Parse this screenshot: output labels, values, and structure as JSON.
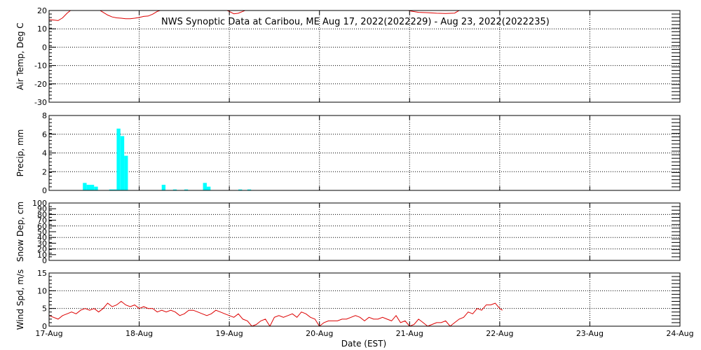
{
  "chart_data": [
    {
      "type": "line",
      "title": "NWS Synoptic Data at Caribou, ME   Aug 17, 2022(2022229) - Aug 23, 2022(2022235)",
      "ylabel": "Air Temp, Deg C",
      "ylim": [
        -30,
        20
      ],
      "yticks": [
        "-30",
        "-20",
        "-10",
        "0",
        "10",
        "20"
      ],
      "x_unit": "days after Aug 17 00:00 EST",
      "series": [
        {
          "color": "#dd0000",
          "x": [
            0.0,
            0.05,
            0.1,
            0.15,
            0.2,
            0.25,
            0.3,
            0.4,
            0.5,
            0.55,
            0.6,
            0.65,
            0.7,
            0.75,
            0.8,
            0.85,
            0.9,
            0.95,
            1.0,
            1.05,
            1.1,
            1.15,
            1.2,
            1.3
          ],
          "y": [
            15,
            14.8,
            14.5,
            16,
            18.5,
            20.5,
            22,
            23,
            22,
            20.5,
            19,
            17.5,
            16.5,
            16,
            15.8,
            15.5,
            15.5,
            15.8,
            16.2,
            16.8,
            17,
            18,
            19.5,
            21
          ]
        },
        {
          "color": "#dd0000",
          "x": [
            1.95,
            2.0,
            2.05,
            2.1,
            2.15,
            2.2,
            2.25
          ],
          "y": [
            20.5,
            19.5,
            18.2,
            18.5,
            19.5,
            20.5,
            22
          ]
        },
        {
          "color": "#dd0000",
          "x": [
            3.9,
            3.95,
            4.0,
            4.1,
            4.2,
            4.3,
            4.4,
            4.5,
            4.55
          ],
          "y": [
            22,
            20.5,
            19.8,
            19,
            18.8,
            18.5,
            18.4,
            18.6,
            20
          ]
        }
      ]
    },
    {
      "type": "bar",
      "ylabel": "Precip, mm",
      "ylim": [
        0,
        8
      ],
      "yticks": [
        "0",
        "2",
        "4",
        "6",
        "8"
      ],
      "color": "#00ffff",
      "bar_width_days": 0.041667,
      "bars": [
        {
          "x": 0.375,
          "value": 0.8
        },
        {
          "x": 0.417,
          "value": 0.6
        },
        {
          "x": 0.458,
          "value": 0.6
        },
        {
          "x": 0.5,
          "value": 0.4
        },
        {
          "x": 0.667,
          "value": 0.1
        },
        {
          "x": 0.708,
          "value": 0.1
        },
        {
          "x": 0.75,
          "value": 6.6
        },
        {
          "x": 0.792,
          "value": 5.8
        },
        {
          "x": 0.833,
          "value": 3.7
        },
        {
          "x": 1.25,
          "value": 0.6
        },
        {
          "x": 1.375,
          "value": 0.1
        },
        {
          "x": 1.5,
          "value": 0.1
        },
        {
          "x": 1.708,
          "value": 0.8
        },
        {
          "x": 1.75,
          "value": 0.4
        },
        {
          "x": 2.1,
          "value": 0.1
        },
        {
          "x": 2.2,
          "value": 0.1
        }
      ]
    },
    {
      "type": "line",
      "ylabel": "Snow Dep, cm",
      "ylim": [
        0,
        100
      ],
      "yticks": [
        "0",
        "20",
        "40",
        "60",
        "80",
        "100"
      ],
      "extra_yticks": [
        "10",
        "30",
        "50",
        "70",
        "90"
      ],
      "series": []
    },
    {
      "type": "line",
      "ylabel": "Wind Spd, m/s",
      "ylim": [
        0,
        15
      ],
      "yticks": [
        "0",
        "5",
        "10",
        "15"
      ],
      "xlabel": "Date (EST)",
      "categories": [
        "17-Aug",
        "18-Aug",
        "19-Aug",
        "20-Aug",
        "21-Aug",
        "22-Aug",
        "23-Aug",
        "24-Aug"
      ],
      "x_unit": "days after Aug 17 00:00 EST",
      "series": [
        {
          "color": "#dd0000",
          "x": [
            0.0,
            0.05,
            0.1,
            0.15,
            0.2,
            0.25,
            0.3,
            0.35,
            0.4,
            0.45,
            0.5,
            0.55,
            0.6,
            0.65,
            0.7,
            0.75,
            0.8,
            0.85,
            0.9,
            0.95,
            1.0,
            1.05,
            1.1,
            1.15,
            1.2,
            1.25,
            1.3,
            1.35,
            1.4,
            1.45,
            1.5,
            1.55,
            1.6,
            1.65,
            1.7,
            1.75,
            1.8,
            1.85,
            1.9,
            1.95,
            2.0,
            2.05,
            2.1,
            2.15,
            2.2,
            2.25,
            2.3,
            2.35,
            2.4,
            2.45,
            2.5,
            2.55,
            2.6,
            2.65,
            2.7,
            2.75,
            2.8,
            2.85,
            2.9,
            2.95,
            3.0,
            3.05,
            3.1,
            3.15,
            3.2,
            3.25,
            3.3,
            3.35,
            3.4,
            3.45,
            3.5,
            3.55,
            3.6,
            3.65,
            3.7,
            3.75,
            3.8,
            3.85,
            3.9,
            3.95,
            4.0,
            4.05,
            4.1,
            4.15,
            4.2,
            4.25,
            4.3,
            4.35,
            4.4,
            4.45,
            4.5,
            4.55,
            4.6,
            4.65,
            4.7,
            4.75,
            4.8,
            4.85,
            4.9,
            4.95,
            5.0,
            5.03
          ],
          "y": [
            3.0,
            2.5,
            2.0,
            3.0,
            3.5,
            4.0,
            3.5,
            4.5,
            5.0,
            4.5,
            5.0,
            4.0,
            5.0,
            6.5,
            5.5,
            6.0,
            7.0,
            6.0,
            5.5,
            6.0,
            5.0,
            5.5,
            5.0,
            5.0,
            4.0,
            4.5,
            4.0,
            4.5,
            4.0,
            3.0,
            3.5,
            4.5,
            4.5,
            4.0,
            3.5,
            3.0,
            3.5,
            4.5,
            4.0,
            3.5,
            3.0,
            2.5,
            3.5,
            2.0,
            1.5,
            0.0,
            0.5,
            1.5,
            2.0,
            0.0,
            2.5,
            3.0,
            2.5,
            3.0,
            3.5,
            2.5,
            4.0,
            3.5,
            2.5,
            2.0,
            0.0,
            1.0,
            1.5,
            1.5,
            1.5,
            2.0,
            2.0,
            2.5,
            3.0,
            2.5,
            1.5,
            2.5,
            2.0,
            2.0,
            2.5,
            2.0,
            1.5,
            3.0,
            1.0,
            1.5,
            0.0,
            0.5,
            2.0,
            1.0,
            0.0,
            0.5,
            1.0,
            1.0,
            1.5,
            0.0,
            1.0,
            2.0,
            2.5,
            4.0,
            3.5,
            5.0,
            4.5,
            6.0,
            6.0,
            6.5,
            5.0,
            4.5
          ]
        }
      ]
    }
  ]
}
